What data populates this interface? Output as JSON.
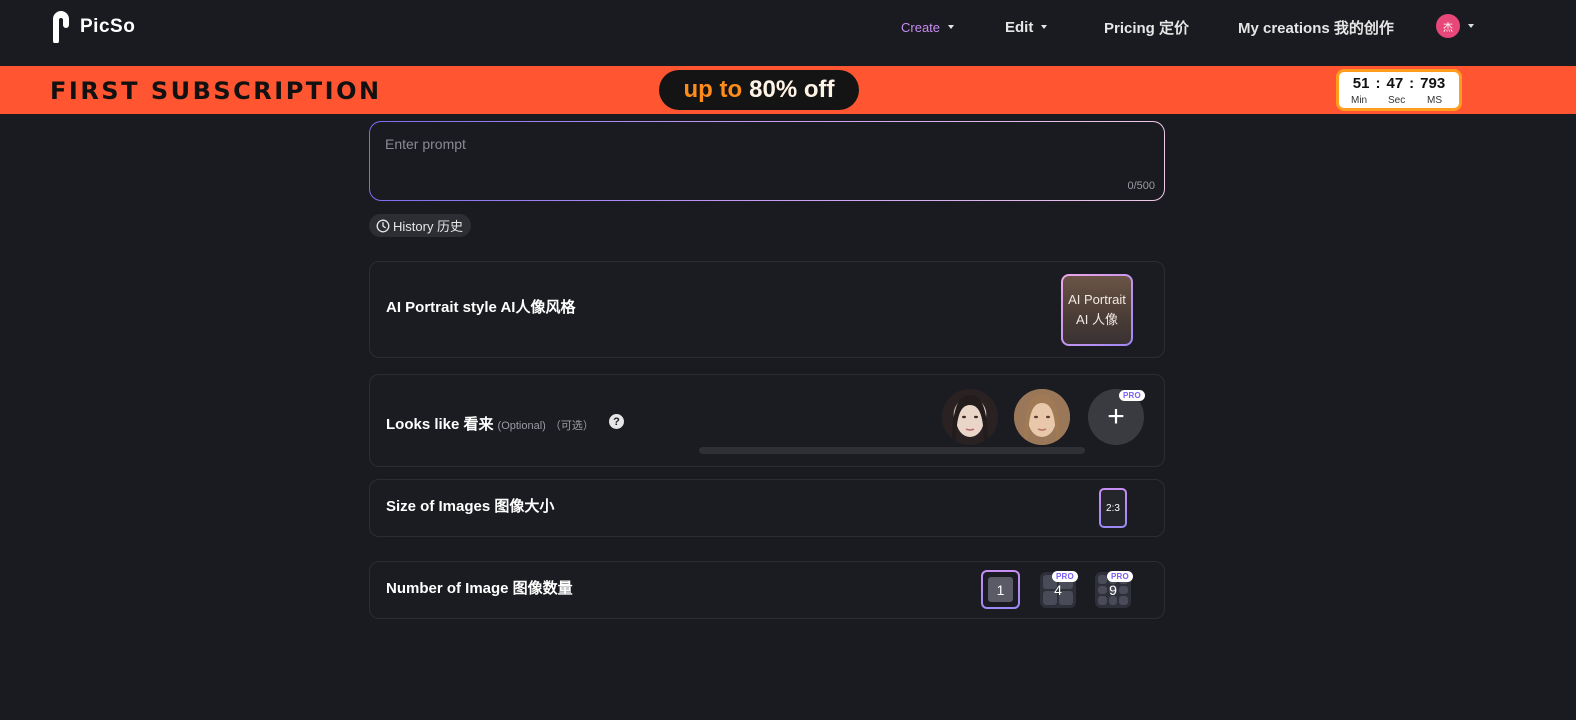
{
  "header": {
    "logo_text": "PicSo",
    "nav": {
      "create": "Create",
      "edit": "Edit",
      "pricing": "Pricing 定价",
      "creations": "My creations 我的创作"
    },
    "avatar_initial": "杰"
  },
  "banner": {
    "title": "FIRST SUBSCRIPTION",
    "offer_prefix": "up to",
    "offer_value": "80% off",
    "timer": {
      "minutes": "51",
      "seconds": "47",
      "milliseconds": "793",
      "separator": ":",
      "min_label": "Min",
      "sec_label": "Sec",
      "ms_label": "MS"
    }
  },
  "prompt": {
    "placeholder": "Enter prompt",
    "value": "",
    "counter": "0/500"
  },
  "history": {
    "label": "History 历史"
  },
  "style_section": {
    "title": "AI Portrait style AI人像风格",
    "thumb_label": "AI Portrait AI 人像"
  },
  "looks_section": {
    "title": "Looks like 看来",
    "optional_en": "(Optional)",
    "optional_zh": "（可选）",
    "help": "?",
    "add": "+",
    "pro": "PRO"
  },
  "size_section": {
    "title": "Size of Images 图像大小",
    "selected_ratio": "2:3"
  },
  "number_section": {
    "title": "Number of Image 图像数量",
    "options": [
      "1",
      "4",
      "9"
    ],
    "selected": "1",
    "pro": "PRO"
  },
  "colors": {
    "background": "#1a1b20",
    "banner": "#ff5530",
    "accent": "#c98ef2",
    "create_nav": "#c78cf0"
  }
}
